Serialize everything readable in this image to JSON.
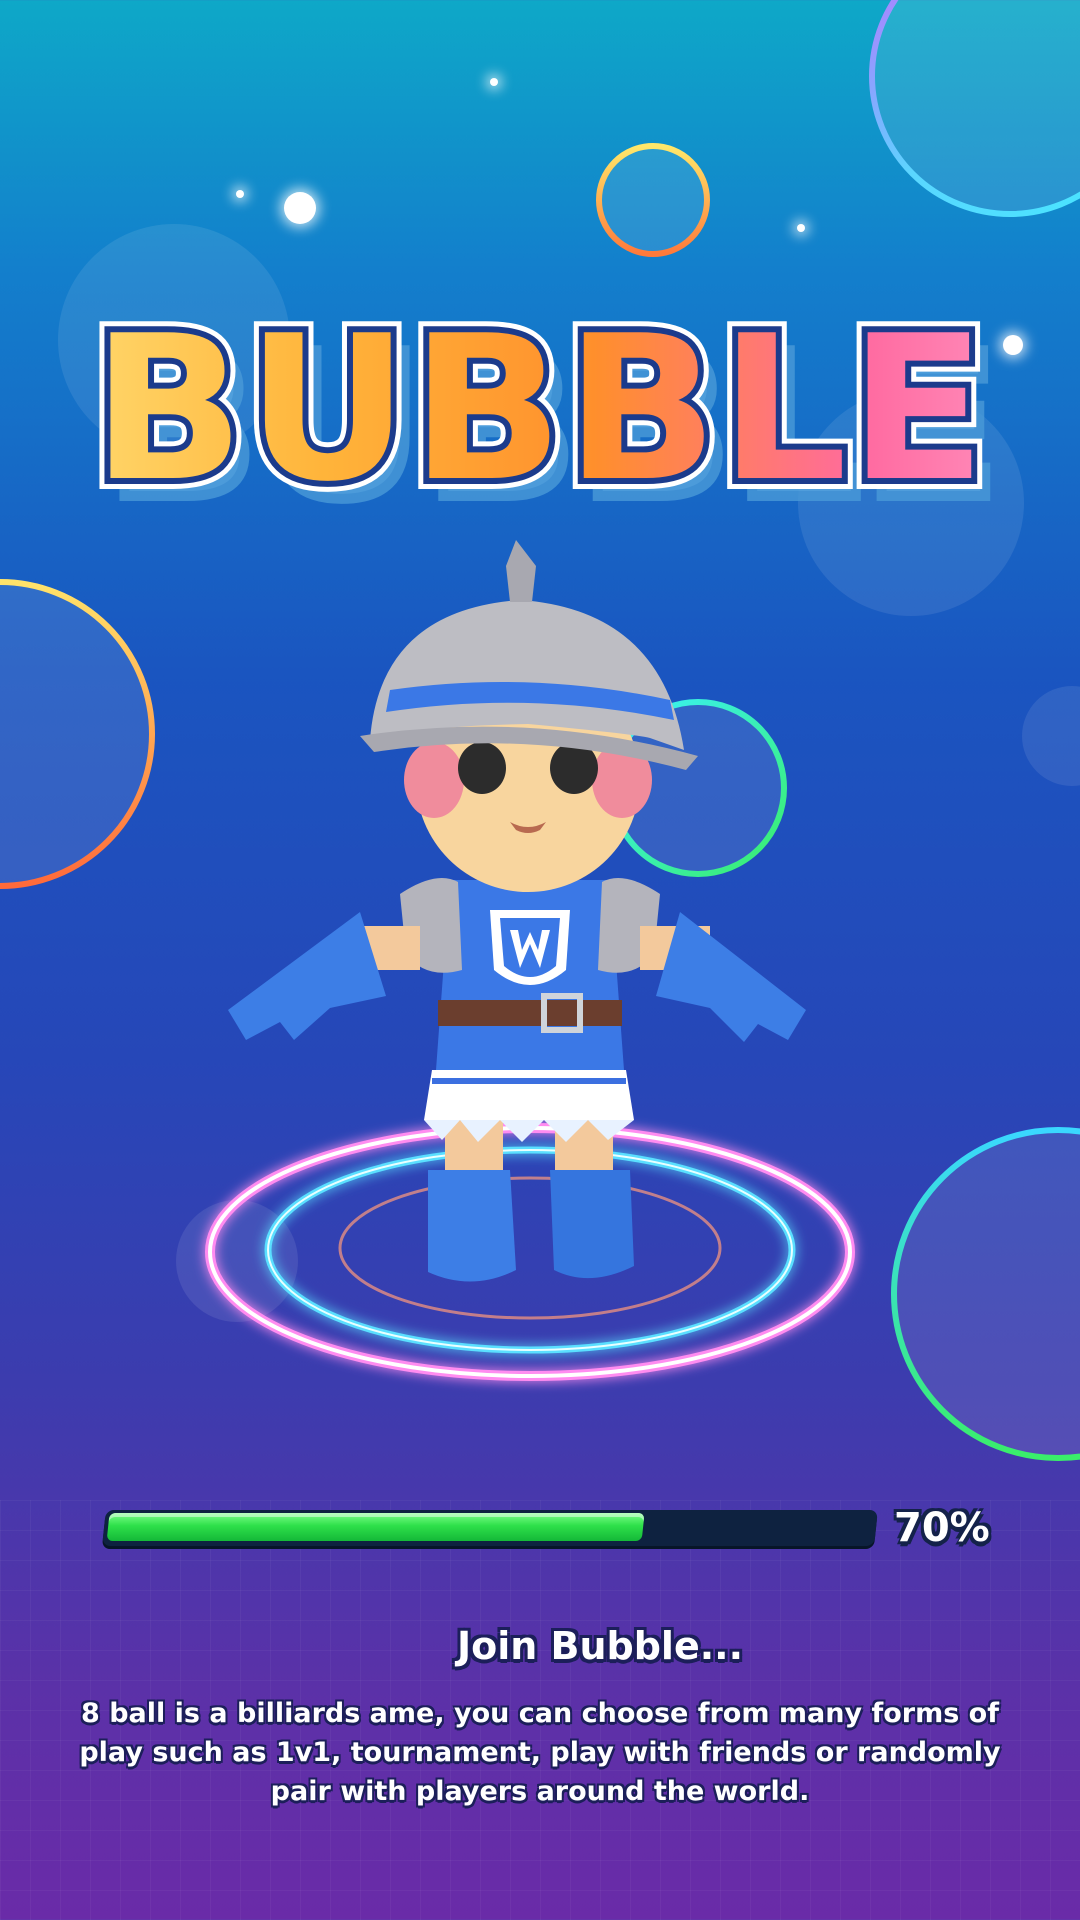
{
  "game": {
    "title": "BUBBLE",
    "loading_progress": 0.7,
    "loading_label": "70%",
    "join_text": "Join Bubble...",
    "description": "8 ball is a billiards ame, you can choose from many forms of play such as 1v1, tournament, play with friends or randomly pair with players around the world."
  },
  "colors": {
    "progress_fill": "#2ee04a",
    "progress_track": "#0e2240",
    "title_gradient_start": "#ffe27a",
    "title_gradient_end": "#ff9ec8",
    "title_outline": "#1b3b8c"
  },
  "icons": {
    "character": "knight-character-icon",
    "platform": "glowing-ring-platform-icon"
  }
}
